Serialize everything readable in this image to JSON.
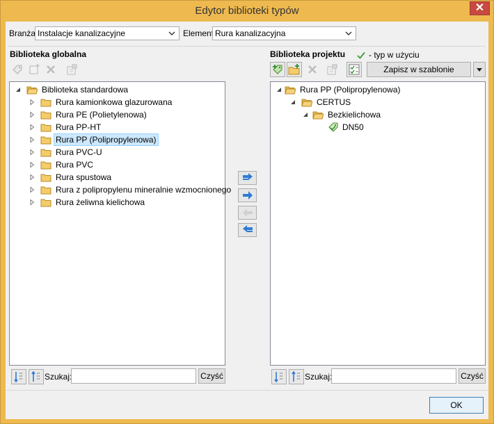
{
  "window": {
    "title": "Edytor biblioteki typów",
    "close_glyph": "✕"
  },
  "filters": {
    "branza_label": "Branża",
    "branza_value": "Instalacje kanalizacyjne",
    "element_label": "Element",
    "element_value": "Rura kanalizacyjna"
  },
  "global_library": {
    "header": "Biblioteka globalna",
    "root": "Biblioteka standardowa",
    "items": [
      "Rura kamionkowa glazurowana",
      "Rura PE (Polietylenowa)",
      "Rura PP-HT",
      "Rura PP (Polipropylenowa)",
      "Rura PVC-U",
      "Rura PVC",
      "Rura spustowa",
      "Rura z polipropylenu mineralnie wzmocnionego",
      "Rura żeliwna kielichowa"
    ],
    "selected_index": 3,
    "search_label": "Szukaj:",
    "search_value": "",
    "clear_label": "Czyść"
  },
  "project_library": {
    "header": "Biblioteka projektu",
    "in_use_legend": "- typ w użyciu",
    "save_template_label": "Zapisz w szablonie",
    "tree": {
      "root": "Rura PP (Polipropylenowa)",
      "manufacturer": "CERTUS",
      "group": "Bezkielichowa",
      "type": "DN50"
    },
    "search_label": "Szukaj:",
    "search_value": "",
    "clear_label": "Czyść"
  },
  "footer": {
    "ok_label": "OK"
  },
  "colors": {
    "title_bar": "#eeb94f",
    "close_button": "#c7493f",
    "folder": "#f4cc6a",
    "selection": "#cce8ff",
    "arrow_blue": "#2e7bd6",
    "check_green": "#3a9a3a"
  }
}
